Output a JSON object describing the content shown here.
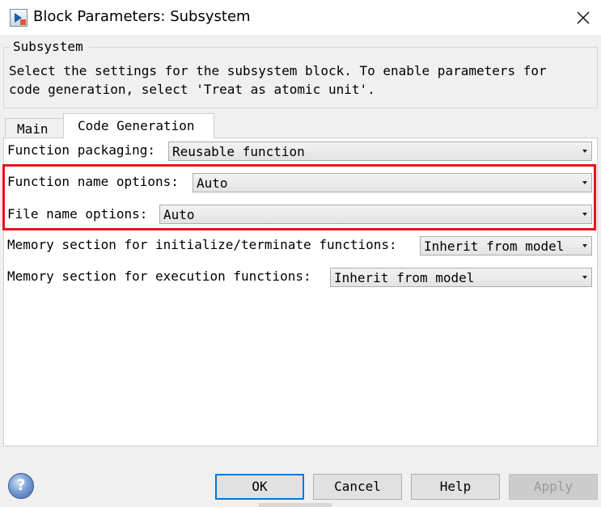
{
  "window": {
    "title": "Block Parameters: Subsystem",
    "icon": "simulink-block-icon",
    "close_icon": "close-icon"
  },
  "group": {
    "legend": "Subsystem",
    "description_line1": "Select the settings for the subsystem block. To enable parameters for",
    "description_line2": "code generation, select 'Treat as atomic unit'."
  },
  "tabs": [
    {
      "label": "Main",
      "active": false
    },
    {
      "label": "Code Generation",
      "active": true
    }
  ],
  "fields": [
    {
      "label": "Function packaging:",
      "value": "Reusable function"
    },
    {
      "label": "Function name options:",
      "value": "Auto"
    },
    {
      "label": "File name options:",
      "value": "Auto"
    },
    {
      "label": "Memory section for initialize/terminate functions:",
      "value": "Inherit from model"
    },
    {
      "label": "Memory section for execution functions:",
      "value": "Inherit from model"
    }
  ],
  "highlight": {
    "color": "#e8131b",
    "covers": [
      "Function name options:",
      "File name options:"
    ]
  },
  "buttons": {
    "help_icon": "?",
    "ok": "OK",
    "cancel": "Cancel",
    "help": "Help",
    "apply": "Apply"
  },
  "colors": {
    "accent": "#0078d7",
    "highlight": "#e8131b",
    "disabled_text": "#9a9a9a"
  }
}
